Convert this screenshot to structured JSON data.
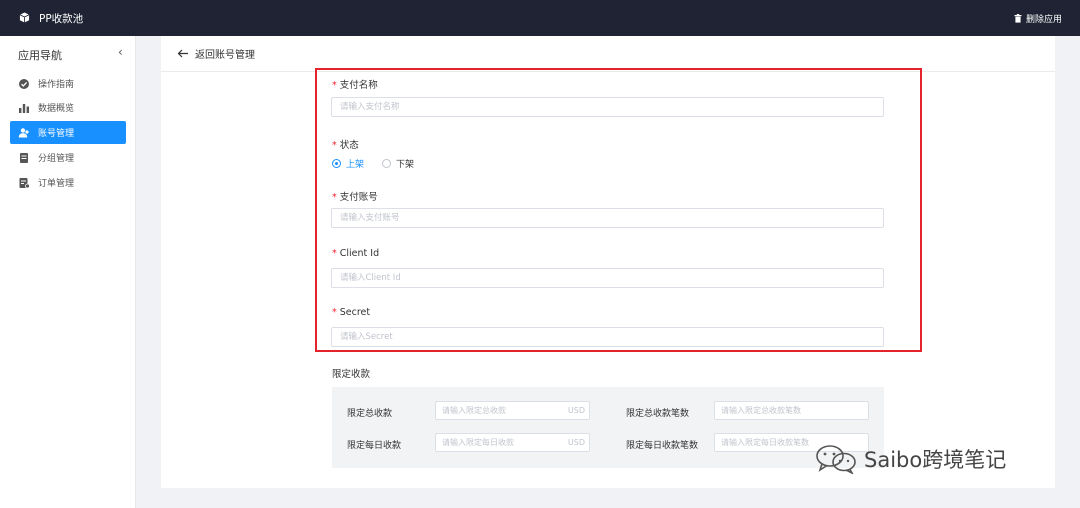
{
  "topbar": {
    "title": "PP收款池",
    "uninstall_label": "删除应用"
  },
  "sidebar": {
    "title": "应用导航",
    "collapse_icon": "‹",
    "items": [
      {
        "label": "操作指南",
        "icon": "check-circle-icon",
        "active": false
      },
      {
        "label": "数据概览",
        "icon": "bar-chart-icon",
        "active": false
      },
      {
        "label": "账号管理",
        "icon": "users-icon",
        "active": true
      },
      {
        "label": "分组管理",
        "icon": "document-icon",
        "active": false
      },
      {
        "label": "订单管理",
        "icon": "list-doc-icon",
        "active": false
      }
    ]
  },
  "page": {
    "back_label": "返回账号管理"
  },
  "form": {
    "required_mark": "*",
    "name": {
      "label": "支付名称",
      "placeholder": "请输入支付名称"
    },
    "status": {
      "label": "状态",
      "options": [
        "上架",
        "下架"
      ],
      "selected": "上架"
    },
    "account": {
      "label": "支付账号",
      "placeholder": "请输入支付账号"
    },
    "client_id": {
      "label": "Client Id",
      "placeholder": "请输入Client Id"
    },
    "secret": {
      "label": "Secret",
      "placeholder": "请输入Secret"
    }
  },
  "limits": {
    "title": "限定收款",
    "total_amount": {
      "label": "限定总收款",
      "placeholder": "请输入限定总收款",
      "unit": "USD"
    },
    "total_count": {
      "label": "限定总收款笔数",
      "placeholder": "请输入限定总收款笔数"
    },
    "daily_amount": {
      "label": "限定每日收款",
      "placeholder": "请输入限定每日收款",
      "unit": "USD"
    },
    "daily_count": {
      "label": "限定每日收款笔数",
      "placeholder": "请输入限定每日收款笔数"
    }
  },
  "watermark": {
    "text": "Saibo跨境笔记"
  },
  "colors": {
    "topbar": "#1f2333",
    "accent": "#1890ff",
    "highlight": "#e3242b",
    "required": "#f5222d"
  }
}
